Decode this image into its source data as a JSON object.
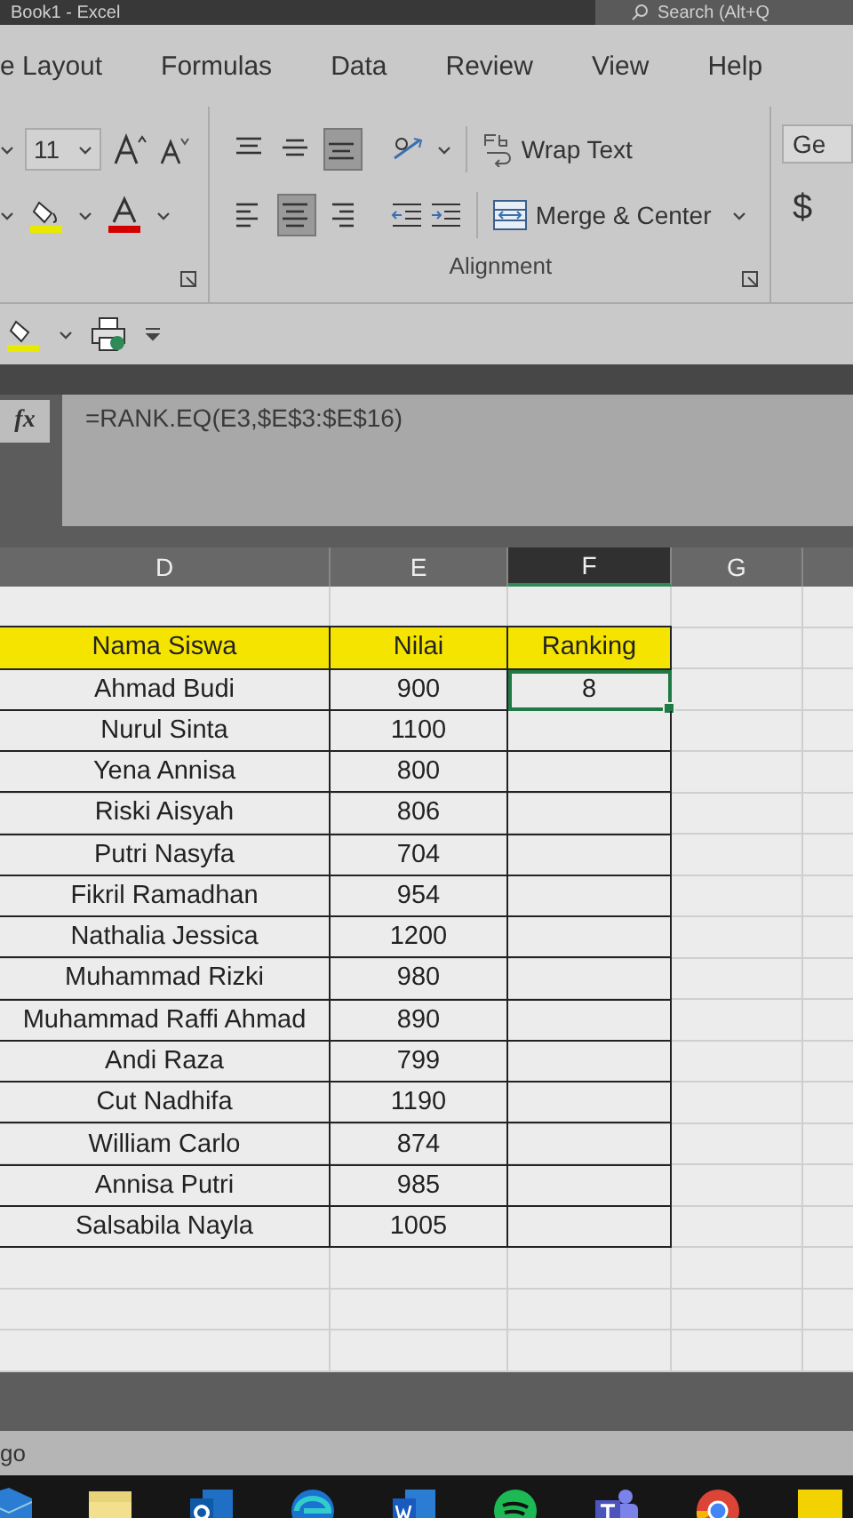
{
  "title_bar": {
    "title": "Book1 - Excel",
    "search": "Search (Alt+Q"
  },
  "tabs": [
    {
      "label": "e Layout"
    },
    {
      "label": "Formulas"
    },
    {
      "label": "Data"
    },
    {
      "label": "Review"
    },
    {
      "label": "View"
    },
    {
      "label": "Help"
    }
  ],
  "ribbon": {
    "font_size": "11",
    "align_rows": [
      [
        {
          "kind": "top",
          "selected": false
        },
        {
          "kind": "middle",
          "selected": false
        },
        {
          "kind": "bottom",
          "selected": true
        }
      ],
      [
        {
          "kind": "left",
          "selected": false
        },
        {
          "kind": "center",
          "selected": true
        },
        {
          "kind": "right",
          "selected": false
        }
      ]
    ],
    "wrap_text": "Wrap Text",
    "merge": "Merge & Center",
    "group_label": "Alignment",
    "number_format": "Ge",
    "currency": "$"
  },
  "formula_bar": {
    "function_label": "fx",
    "formula": "=RANK.EQ(E3,$E$3:$E$16)"
  },
  "sheet": {
    "columns": [
      {
        "label": "D",
        "selected": false
      },
      {
        "label": "E",
        "selected": false
      },
      {
        "label": "F",
        "selected": true
      },
      {
        "label": "G",
        "selected": false
      }
    ],
    "header": [
      "Nama Siswa",
      "Nilai",
      "Ranking"
    ],
    "rows": [
      {
        "name": "Ahmad Budi",
        "score": "900",
        "rank": "8",
        "selected": true
      },
      {
        "name": "Nurul Sinta",
        "score": "1100",
        "selected": false
      },
      {
        "name": "Yena Annisa",
        "score": "800",
        "selected": false
      },
      {
        "name": "Riski Aisyah",
        "score": "806",
        "selected": false
      },
      {
        "name": "Putri Nasyfa",
        "score": "704",
        "selected": false
      },
      {
        "name": "Fikril Ramadhan",
        "score": "954",
        "selected": false
      },
      {
        "name": "Nathalia Jessica",
        "score": "1200",
        "selected": false
      },
      {
        "name": "Muhammad Rizki",
        "score": "980",
        "selected": false
      },
      {
        "name": "Muhammad Raffi Ahmad",
        "score": "890",
        "selected": false
      },
      {
        "name": "Andi Raza",
        "score": "799",
        "selected": false
      },
      {
        "name": "Cut Nadhifa",
        "score": "1190",
        "selected": false
      },
      {
        "name": "William Carlo",
        "score": "874",
        "selected": false
      },
      {
        "name": "Annisa Putri",
        "score": "985",
        "selected": false
      },
      {
        "name": "Salsabila Nayla",
        "score": "1005",
        "selected": false
      }
    ]
  },
  "status_bar": {
    "text": "go"
  }
}
